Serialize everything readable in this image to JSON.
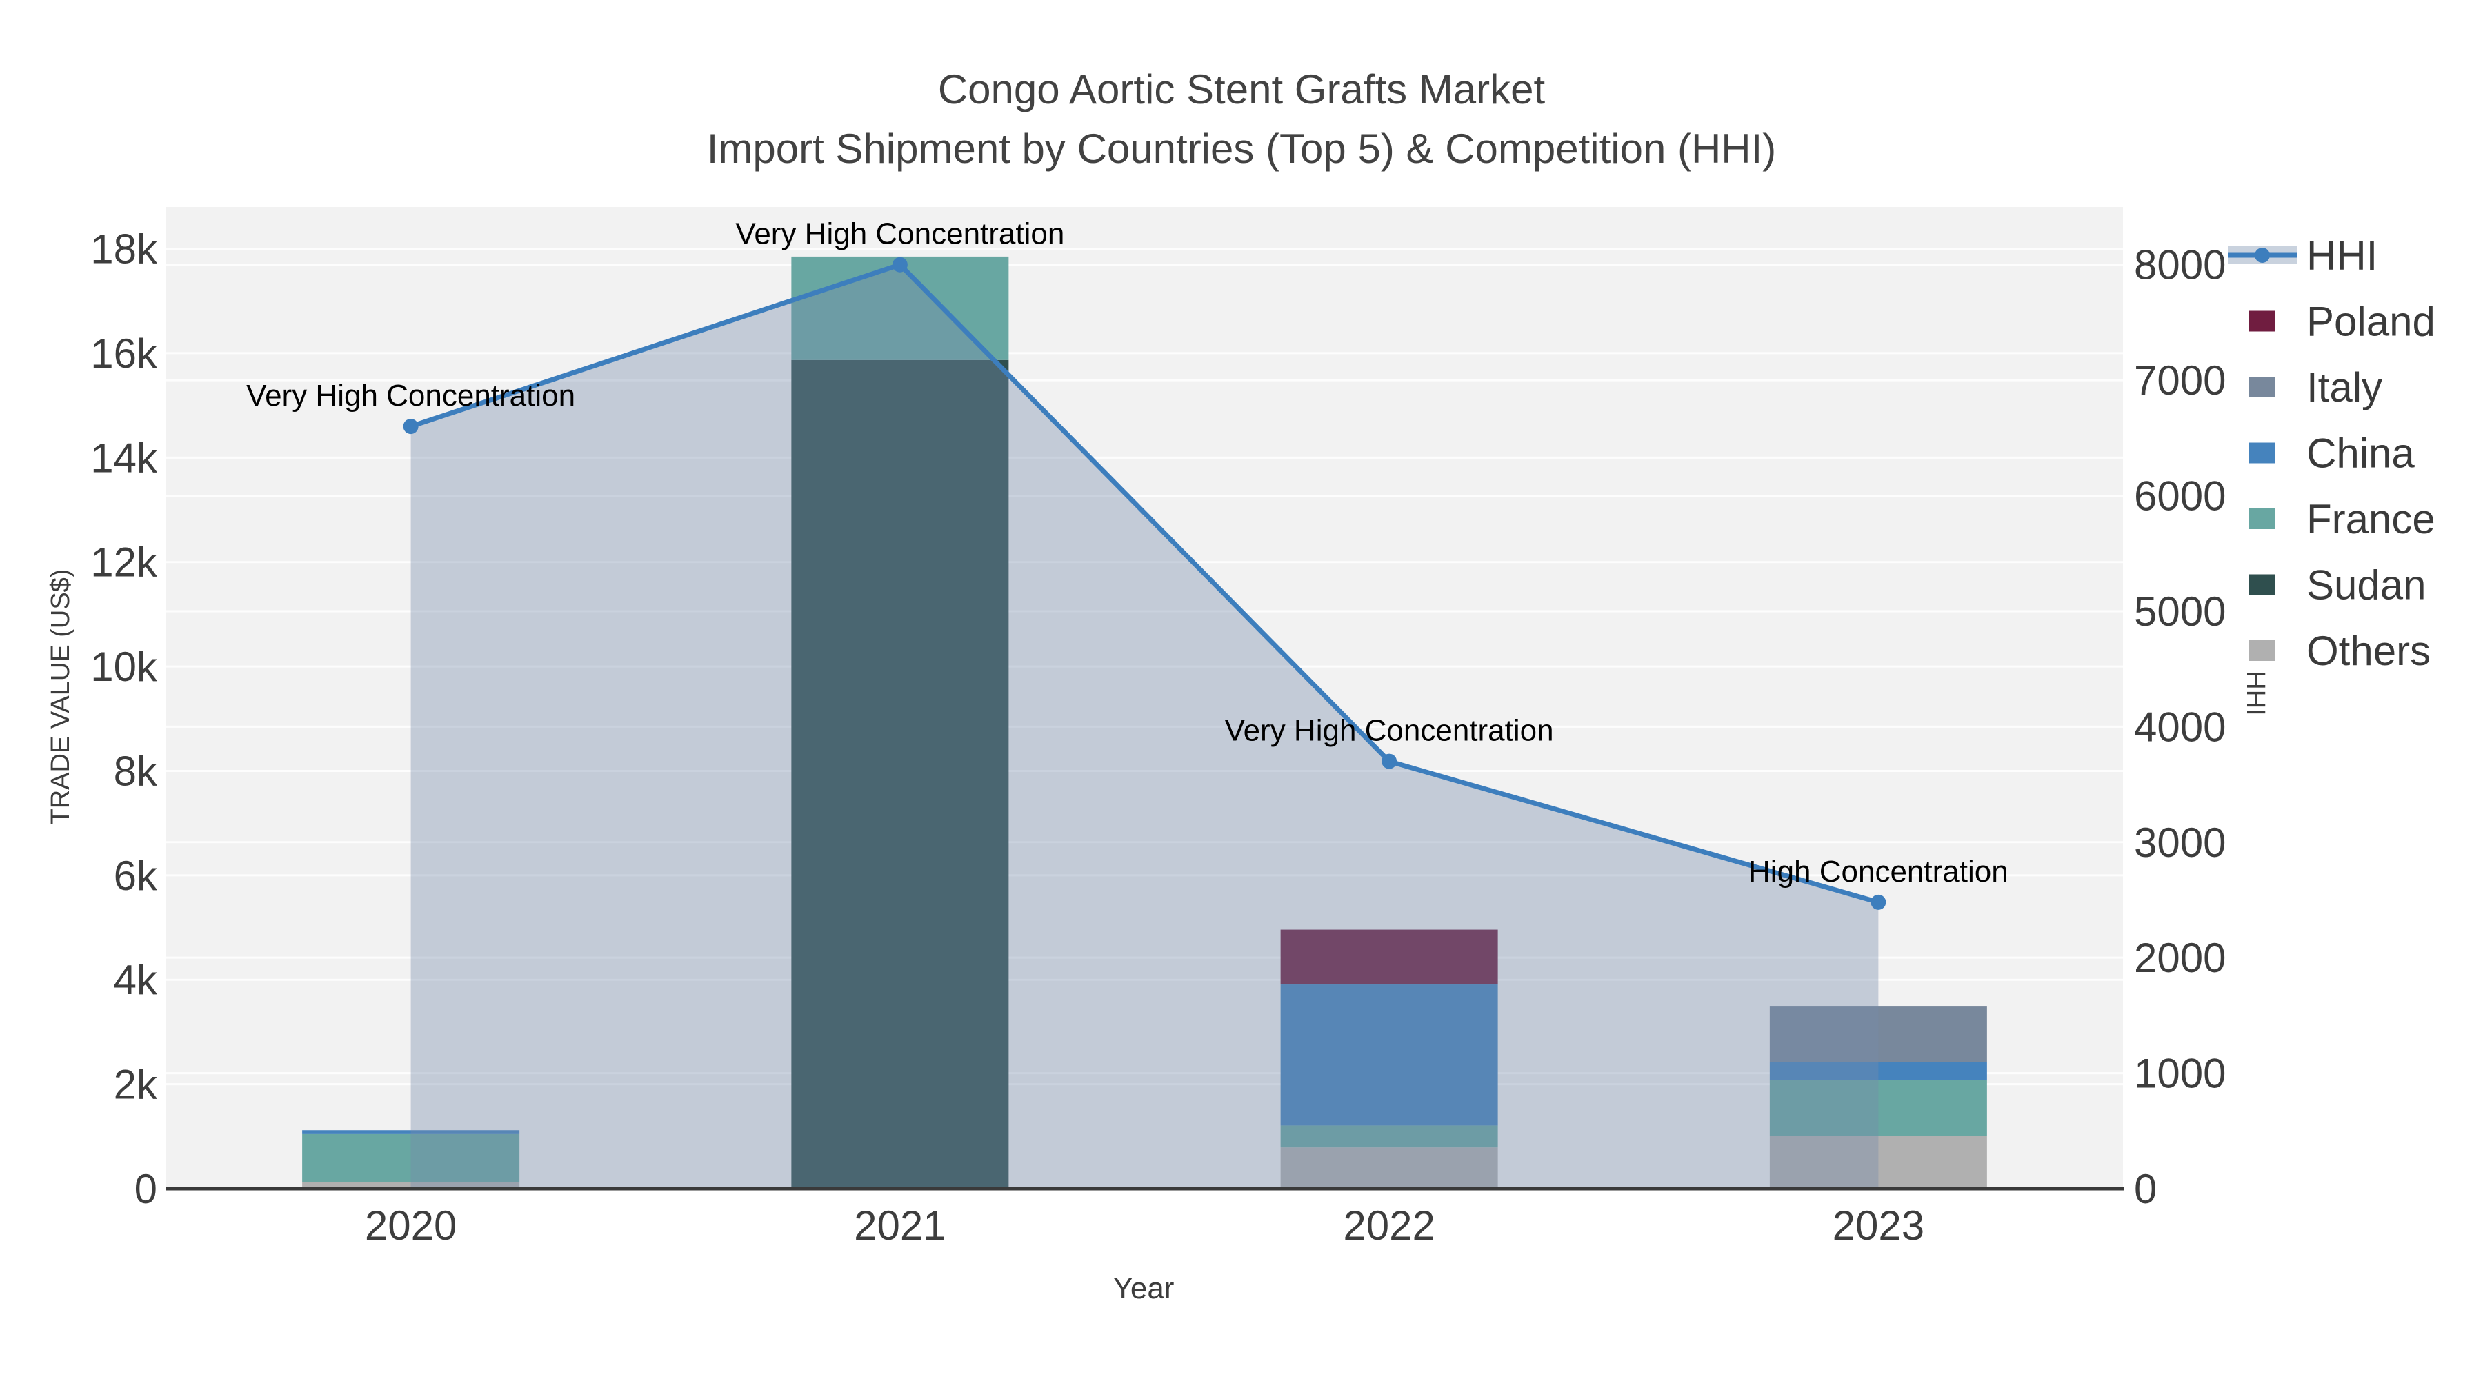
{
  "title": {
    "line1": "Congo Aortic Stent Grafts Market",
    "line2": "Import Shipment by Countries (Top 5) & Competition (HHI)"
  },
  "chart_data": {
    "type": "combo-stacked-bar-line",
    "categories": [
      "2020",
      "2021",
      "2022",
      "2023"
    ],
    "x_axis": {
      "title": "Year"
    },
    "left_axis": {
      "title": "TRADE VALUE (US$)",
      "range": [
        0,
        18800
      ],
      "tick_values": [
        0,
        2000,
        4000,
        6000,
        8000,
        10000,
        12000,
        14000,
        16000,
        18000
      ],
      "tick_labels": [
        "0",
        "2k",
        "4k",
        "6k",
        "8k",
        "10k",
        "12k",
        "14k",
        "16k",
        "18k"
      ]
    },
    "right_axis": {
      "title": "HHI",
      "range": [
        0,
        8500
      ],
      "tick_values": [
        0,
        1000,
        2000,
        3000,
        4000,
        5000,
        6000,
        7000,
        8000
      ],
      "tick_labels": [
        "0",
        "1000",
        "2000",
        "3000",
        "4000",
        "5000",
        "6000",
        "7000",
        "8000"
      ]
    },
    "bar_stack_bottom_to_top": [
      "Others",
      "Sudan",
      "France",
      "China",
      "Italy",
      "Poland"
    ],
    "series": [
      {
        "name": "HHI",
        "type": "line+area",
        "axis": "right",
        "color": "#3d7ebd",
        "fill_color": "rgba(118,139,172,0.38)",
        "values": [
          6600,
          8000,
          3700,
          2480
        ]
      },
      {
        "name": "Poland",
        "type": "bar",
        "axis": "left",
        "color": "#701d40",
        "values": [
          0,
          0,
          1050,
          0
        ]
      },
      {
        "name": "Italy",
        "type": "bar",
        "axis": "left",
        "color": "#78889c",
        "values": [
          0,
          0,
          0,
          1080
        ]
      },
      {
        "name": "China",
        "type": "bar",
        "axis": "left",
        "color": "#4583bd",
        "values": [
          75,
          0,
          2700,
          340
        ]
      },
      {
        "name": "France",
        "type": "bar",
        "axis": "left",
        "color": "#68a7a2",
        "values": [
          920,
          1980,
          420,
          1070
        ]
      },
      {
        "name": "Sudan",
        "type": "bar",
        "axis": "left",
        "color": "#2f4f4e",
        "values": [
          0,
          15870,
          0,
          0
        ]
      },
      {
        "name": "Others",
        "type": "bar",
        "axis": "left",
        "color": "#b0b0b0",
        "values": [
          125,
          0,
          790,
          1010
        ]
      }
    ],
    "bar_totals": [
      1120,
      17850,
      4960,
      3500
    ],
    "annotations": [
      {
        "category": "2020",
        "text": "Very High Concentration"
      },
      {
        "category": "2021",
        "text": "Very High Concentration"
      },
      {
        "category": "2022",
        "text": "Very High Concentration"
      },
      {
        "category": "2023",
        "text": "High Concentration"
      }
    ],
    "legend": {
      "position": "top-right",
      "items": [
        "HHI",
        "Poland",
        "Italy",
        "China",
        "France",
        "Sudan",
        "Others"
      ],
      "hhi_band_color": "#c9d2de"
    },
    "grid": true
  },
  "colors": {
    "background": "#ffffff",
    "plot_bg": "#f2f2f2",
    "grid": "#ffffff",
    "axis_line": "#3a3a3a",
    "tick_text": "#3d3d3d",
    "title_text": "#424242",
    "annotation_text": "#000000"
  }
}
